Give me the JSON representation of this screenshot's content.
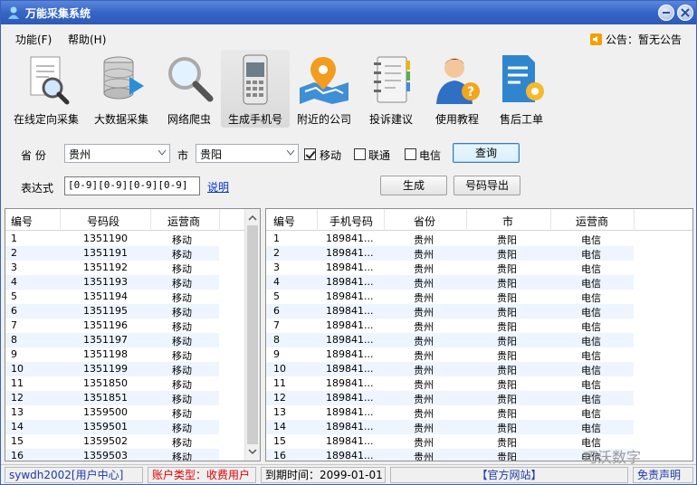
{
  "window": {
    "title": "万能采集系统",
    "colors": {
      "titlebar": "#3565c6",
      "selected_row": "#eef5ff",
      "link": "#0033cc",
      "account_type": "#e00000"
    }
  },
  "menu": {
    "func": "功能(F)",
    "help": "帮助(H)"
  },
  "notice": {
    "text": "公告：暂无公告",
    "icon": "speaker-icon"
  },
  "toolbar": {
    "items": [
      {
        "label": "在线定向采集",
        "icon": "document-search-icon"
      },
      {
        "label": "大数据采集",
        "icon": "database-play-icon"
      },
      {
        "label": "网络爬虫",
        "icon": "magnifier-icon"
      },
      {
        "label": "生成手机号",
        "icon": "mobile-phone-icon"
      },
      {
        "label": "附近的公司",
        "icon": "map-pin-icon"
      },
      {
        "label": "投诉建议",
        "icon": "notebook-icon"
      },
      {
        "label": "使用教程",
        "icon": "user-help-icon"
      },
      {
        "label": "售后工单",
        "icon": "ticket-gear-icon"
      }
    ]
  },
  "controls": {
    "province_label": "省 份",
    "province_value": "贵州",
    "city_label": "市",
    "city_value": "贵阳",
    "mobile_label": "移动",
    "mobile_checked": true,
    "unicom_label": "联通",
    "unicom_checked": false,
    "telecom_label": "电信",
    "telecom_checked": false,
    "query_button": "查询",
    "expr_label": "表达式",
    "expr_value": "[0-9][0-9][0-9][0-9]",
    "explain_link": "说明",
    "generate_button": "生成",
    "export_button": "号码导出"
  },
  "left_table": {
    "headers": [
      "编号",
      "号码段",
      "运营商"
    ],
    "rows": [
      [
        "1",
        "1351190",
        "移动"
      ],
      [
        "2",
        "1351191",
        "移动"
      ],
      [
        "3",
        "1351192",
        "移动"
      ],
      [
        "4",
        "1351193",
        "移动"
      ],
      [
        "5",
        "1351194",
        "移动"
      ],
      [
        "6",
        "1351195",
        "移动"
      ],
      [
        "7",
        "1351196",
        "移动"
      ],
      [
        "8",
        "1351197",
        "移动"
      ],
      [
        "9",
        "1351198",
        "移动"
      ],
      [
        "10",
        "1351199",
        "移动"
      ],
      [
        "11",
        "1351850",
        "移动"
      ],
      [
        "12",
        "1351851",
        "移动"
      ],
      [
        "13",
        "1359500",
        "移动"
      ],
      [
        "14",
        "1359501",
        "移动"
      ],
      [
        "15",
        "1359502",
        "移动"
      ],
      [
        "16",
        "1359503",
        "移动"
      ]
    ]
  },
  "right_table": {
    "headers": [
      "编号",
      "手机号码",
      "省份",
      "市",
      "运营商"
    ],
    "rows": [
      [
        "1",
        "189841...",
        "贵州",
        "贵阳",
        "电信"
      ],
      [
        "2",
        "189841...",
        "贵州",
        "贵阳",
        "电信"
      ],
      [
        "3",
        "189841...",
        "贵州",
        "贵阳",
        "电信"
      ],
      [
        "4",
        "189841...",
        "贵州",
        "贵阳",
        "电信"
      ],
      [
        "5",
        "189841...",
        "贵州",
        "贵阳",
        "电信"
      ],
      [
        "6",
        "189841...",
        "贵州",
        "贵阳",
        "电信"
      ],
      [
        "7",
        "189841...",
        "贵州",
        "贵阳",
        "电信"
      ],
      [
        "8",
        "189841...",
        "贵州",
        "贵阳",
        "电信"
      ],
      [
        "9",
        "189841...",
        "贵州",
        "贵阳",
        "电信"
      ],
      [
        "10",
        "189841...",
        "贵州",
        "贵阳",
        "电信"
      ],
      [
        "11",
        "189841...",
        "贵州",
        "贵阳",
        "电信"
      ],
      [
        "12",
        "189841...",
        "贵州",
        "贵阳",
        "电信"
      ],
      [
        "13",
        "189841...",
        "贵州",
        "贵阳",
        "电信"
      ],
      [
        "14",
        "189841...",
        "贵州",
        "贵阳",
        "电信"
      ],
      [
        "15",
        "189841...",
        "贵州",
        "贵阳",
        "电信"
      ],
      [
        "16",
        "189841...",
        "贵州",
        "贵阳",
        "电信"
      ]
    ]
  },
  "status": {
    "user": "sywdh2002[用户中心]",
    "account_type": "账户类型：收费用户",
    "expiry": "到期时间：2099-01-01",
    "official_site": "【官方网站】",
    "disclaimer": "免责声明"
  },
  "watermark": "巧沃数字"
}
